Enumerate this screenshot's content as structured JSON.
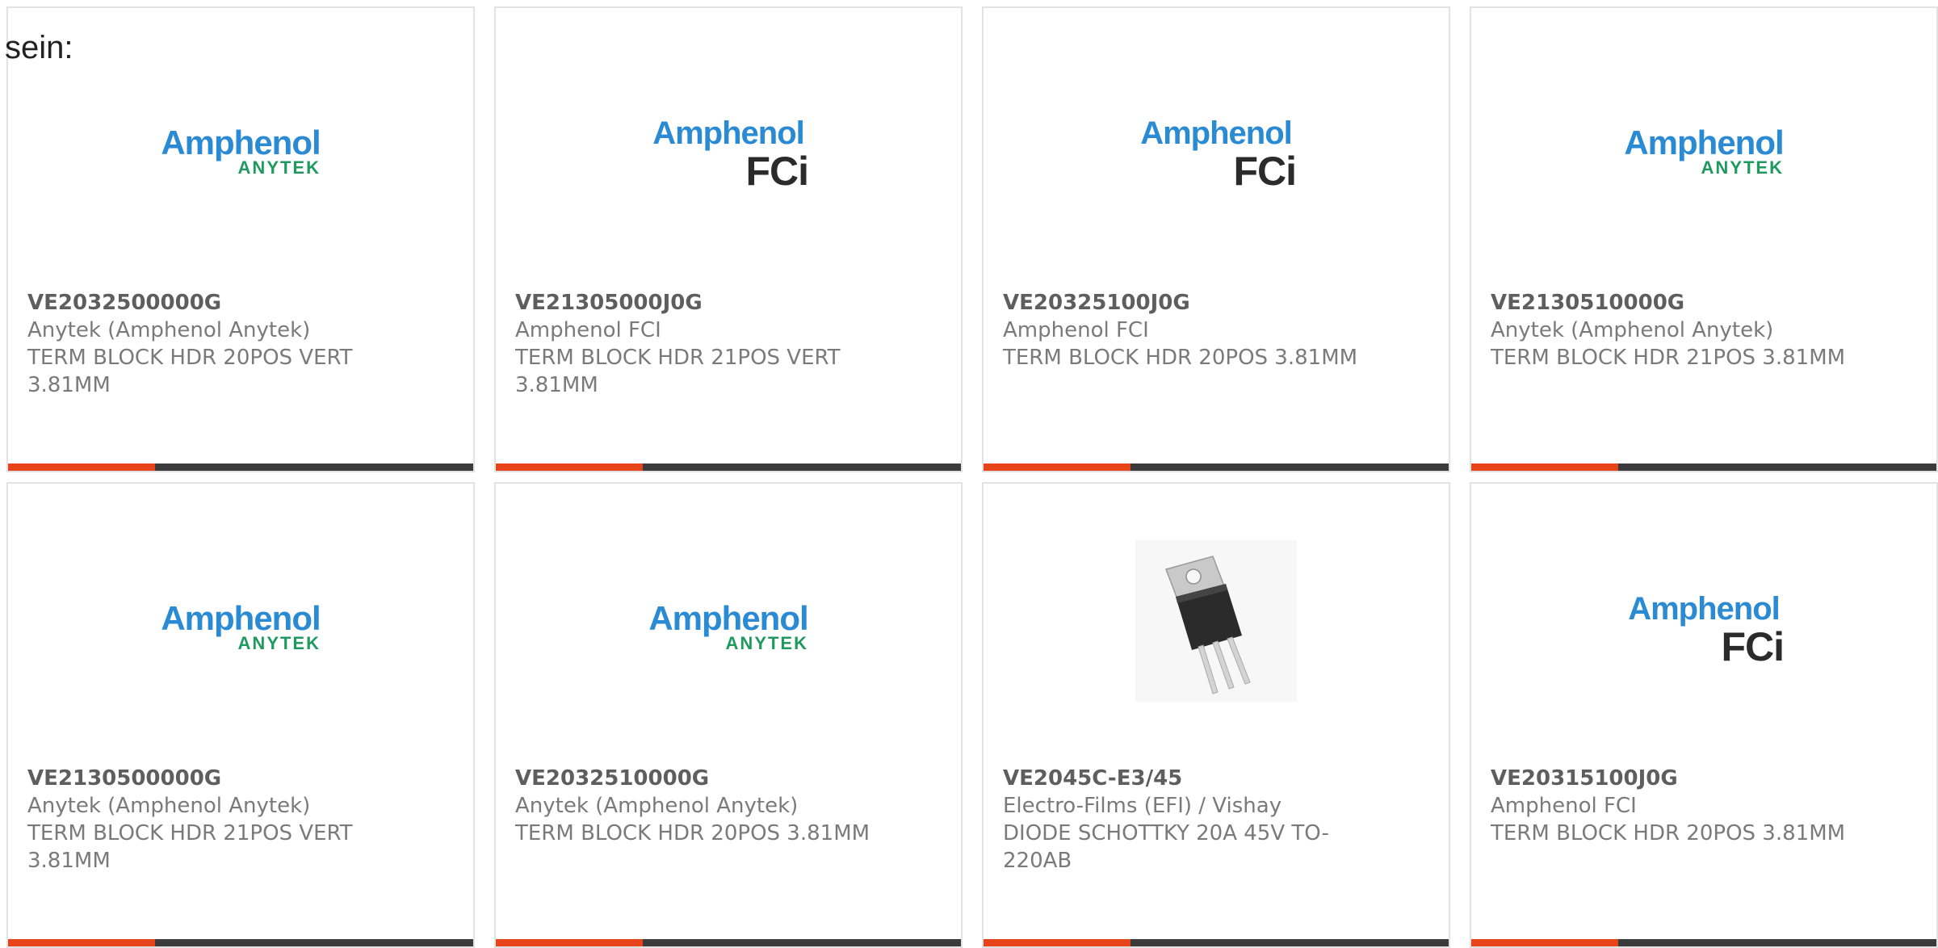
{
  "top_label": "sein:",
  "colors": {
    "accent": "#e8441c",
    "bar": "#3b3b3b",
    "brand_blue": "#2a8ad4",
    "brand_green": "#1f9a5e"
  },
  "products": [
    {
      "image": "logo-amphenol-anytek",
      "logo_primary": "Amphenol",
      "logo_secondary": "ANYTEK",
      "part_number": "VE2032500000G",
      "manufacturer": "Anytek (Amphenol Anytek)",
      "description": "TERM BLOCK HDR 20POS VERT 3.81MM"
    },
    {
      "image": "logo-amphenol-fci",
      "logo_primary": "Amphenol",
      "logo_secondary": "FCi",
      "part_number": "VE21305000J0G",
      "manufacturer": "Amphenol FCI",
      "description": "TERM BLOCK HDR 21POS VERT 3.81MM"
    },
    {
      "image": "logo-amphenol-fci",
      "logo_primary": "Amphenol",
      "logo_secondary": "FCi",
      "part_number": "VE20325100J0G",
      "manufacturer": "Amphenol FCI",
      "description": "TERM BLOCK HDR 20POS 3.81MM"
    },
    {
      "image": "logo-amphenol-anytek",
      "logo_primary": "Amphenol",
      "logo_secondary": "ANYTEK",
      "part_number": "VE2130510000G",
      "manufacturer": "Anytek (Amphenol Anytek)",
      "description": "TERM BLOCK HDR 21POS 3.81MM"
    },
    {
      "image": "logo-amphenol-anytek",
      "logo_primary": "Amphenol",
      "logo_secondary": "ANYTEK",
      "part_number": "VE2130500000G",
      "manufacturer": "Anytek (Amphenol Anytek)",
      "description": "TERM BLOCK HDR 21POS VERT 3.81MM"
    },
    {
      "image": "logo-amphenol-anytek",
      "logo_primary": "Amphenol",
      "logo_secondary": "ANYTEK",
      "part_number": "VE2032510000G",
      "manufacturer": "Anytek (Amphenol Anytek)",
      "description": "TERM BLOCK HDR 20POS 3.81MM"
    },
    {
      "image": "transistor-to220-photo",
      "part_number": "VE2045C-E3/45",
      "manufacturer": "Electro-Films (EFI) / Vishay",
      "description": "DIODE SCHOTTKY 20A 45V TO-220AB"
    },
    {
      "image": "logo-amphenol-fci",
      "logo_primary": "Amphenol",
      "logo_secondary": "FCi",
      "part_number": "VE20315100J0G",
      "manufacturer": "Amphenol FCI",
      "description": "TERM BLOCK HDR 20POS 3.81MM"
    }
  ]
}
